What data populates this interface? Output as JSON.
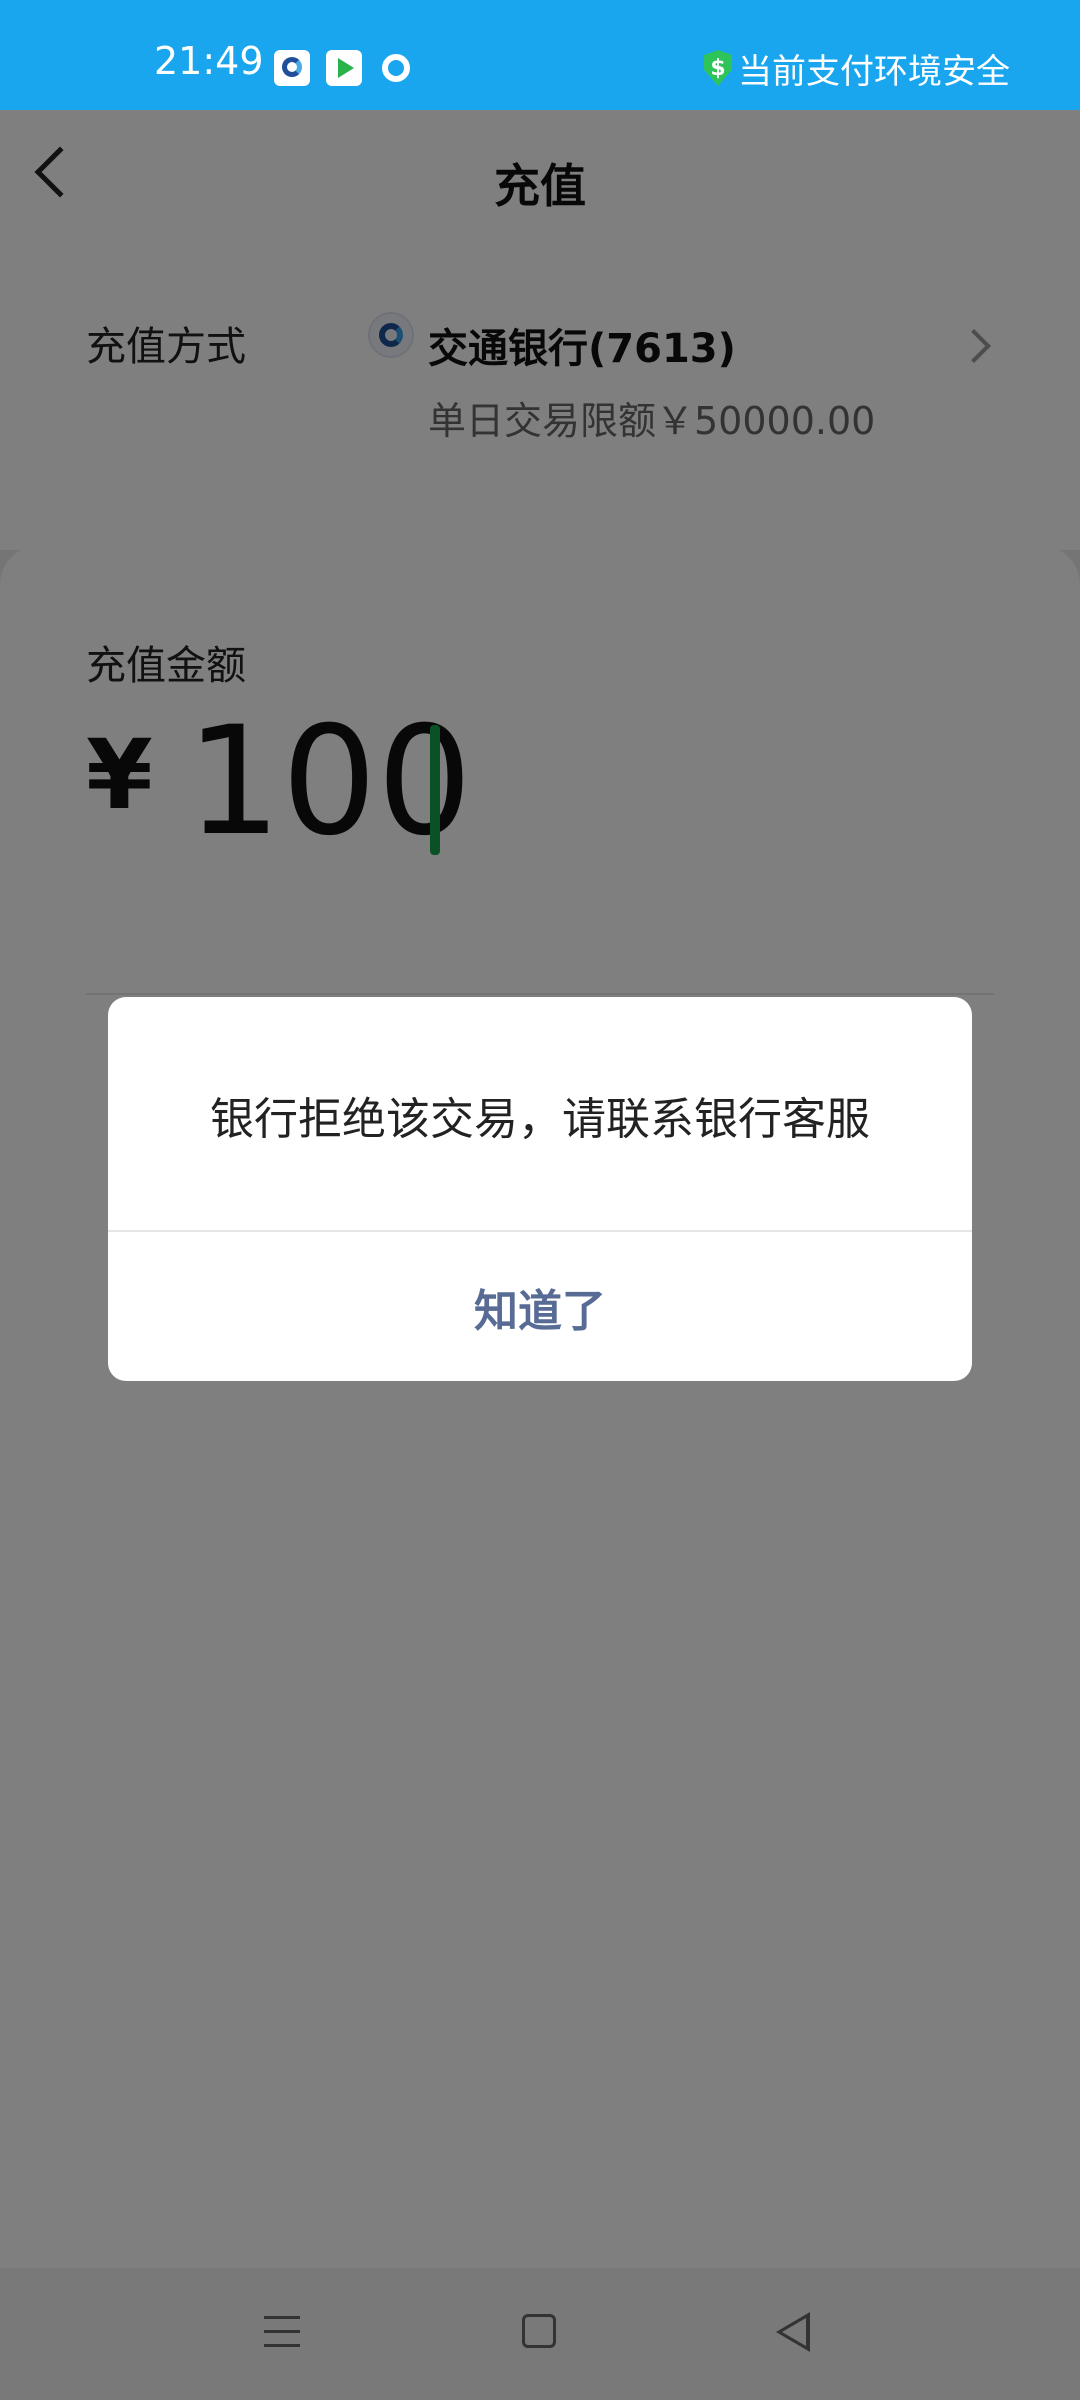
{
  "status_bar": {
    "time": "21:49",
    "safe_text": "当前支付环境安全",
    "icons": [
      "bank-app-icon",
      "video-app-icon",
      "search-app-icon",
      "shield-icon"
    ]
  },
  "header": {
    "title": "充值"
  },
  "payment_method": {
    "label": "充值方式",
    "bank_name": "交通银行(7613)",
    "limit_text": "单日交易限额￥50000.00"
  },
  "amount": {
    "label": "充值金额",
    "currency": "¥",
    "value": "100"
  },
  "dialog": {
    "message": "银行拒绝该交易，请联系银行客服",
    "button": "知道了"
  },
  "colors": {
    "status_bar": "#19a6ef",
    "caret": "#15a24a",
    "dialog_button": "#576b95"
  }
}
